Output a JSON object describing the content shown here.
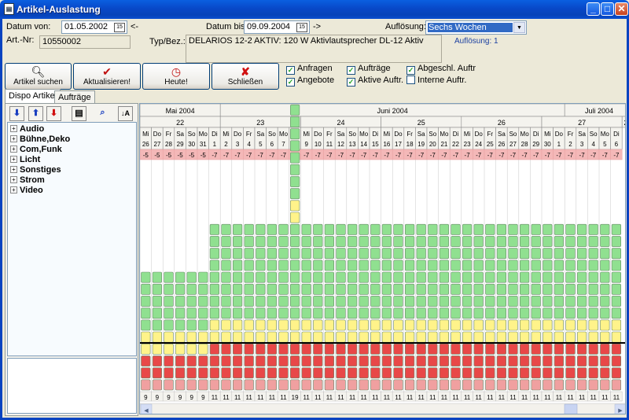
{
  "window": {
    "title": "Artikel-Auslastung"
  },
  "filter": {
    "datum_von_label": "Datum von:",
    "datum_von": "01.05.2002",
    "prev_arrow": "<-",
    "datum_bis_label": "Datum bis:",
    "datum_bis": "09.09.2004",
    "next_arrow": "->",
    "aufloesung_label": "Auflösung:",
    "aufloesung": "Sechs Wochen",
    "aufloesung_info": "Auflösung: 1"
  },
  "article": {
    "artnr_label": "Art.-Nr:",
    "artnr": "10550002",
    "typ_label": "Typ/Bez.:",
    "typ": "DELARIOS 12-2 AKTIV: 120 W Aktivlautsprecher DL-12 Aktiv"
  },
  "buttons": {
    "suchen": "Artikel suchen",
    "aktualisieren": "Aktualisieren!",
    "heute": "Heute!",
    "schliessen": "Schließen"
  },
  "checks": [
    {
      "label": "Anfragen",
      "checked": true
    },
    {
      "label": "Aufträge",
      "checked": true
    },
    {
      "label": "Abgeschl. Auftr",
      "checked": true
    },
    {
      "label": "Angebote",
      "checked": true
    },
    {
      "label": "Aktive Auftr.",
      "checked": true
    },
    {
      "label": "Interne Auftr.",
      "checked": false
    }
  ],
  "tabs": [
    "Dispo Artikel",
    "Aufträge"
  ],
  "tree": [
    "Audio",
    "Bühne,Deko",
    "Com,Funk",
    "Licht",
    "Sonstiges",
    "Strom",
    "Video"
  ],
  "grid": {
    "months": [
      {
        "label": "Mai 2004",
        "span": 7
      },
      {
        "label": "Juni 2004",
        "span": 30
      },
      {
        "label": "Juli 2004",
        "span": 6
      }
    ],
    "weeks": [
      {
        "label": "22",
        "span": 7
      },
      {
        "label": "23",
        "span": 7
      },
      {
        "label": "24",
        "span": 7
      },
      {
        "label": "25",
        "span": 7
      },
      {
        "label": "26",
        "span": 7
      },
      {
        "label": "27",
        "span": 7
      },
      {
        "label": "28",
        "span": 1
      }
    ],
    "weekdays": [
      "Mi",
      "Do",
      "Fr",
      "Sa",
      "So",
      "Mo",
      "Di",
      "Mi",
      "Do",
      "Fr",
      "Sa",
      "So",
      "Mo",
      "Di",
      "Mi",
      "Do",
      "Fr",
      "Sa",
      "So",
      "Mo",
      "Di",
      "Mi",
      "Do",
      "Fr",
      "Sa",
      "So",
      "Mo",
      "Di",
      "Mi",
      "Do",
      "Fr",
      "Sa",
      "So",
      "Mo",
      "Di",
      "Mi",
      "Do",
      "Fr",
      "Sa",
      "So",
      "Mo",
      "Di",
      "Mi"
    ],
    "days": [
      "26",
      "27",
      "28",
      "29",
      "30",
      "31",
      "1",
      "2",
      "3",
      "4",
      "5",
      "6",
      "7",
      "8",
      "9",
      "10",
      "11",
      "12",
      "13",
      "14",
      "15",
      "16",
      "17",
      "18",
      "19",
      "20",
      "21",
      "22",
      "23",
      "24",
      "25",
      "26",
      "27",
      "28",
      "29",
      "30",
      "1",
      "2",
      "3",
      "4",
      "5",
      "6"
    ],
    "today_index": 42,
    "balance": [
      "-5",
      "-5",
      "-5",
      "-5",
      "-5",
      "-5",
      "-7",
      "-7",
      "-7",
      "-7",
      "-7",
      "-7",
      "-7",
      "-15",
      "-7",
      "-7",
      "-7",
      "-7",
      "-7",
      "-7",
      "-7",
      "-7",
      "-7",
      "-7",
      "-7",
      "-7",
      "-7",
      "-7",
      "-7",
      "-7",
      "-7",
      "-7",
      "-7",
      "-7",
      "-7",
      "-7",
      "-7",
      "-7",
      "-7",
      "-7",
      "-7",
      "-7",
      "-7"
    ],
    "totals": [
      "9",
      "9",
      "9",
      "9",
      "9",
      "9",
      "11",
      "11",
      "11",
      "11",
      "11",
      "11",
      "11",
      "19",
      "11",
      "11",
      "11",
      "11",
      "11",
      "11",
      "11",
      "11",
      "11",
      "11",
      "11",
      "11",
      "11",
      "11",
      "11",
      "11",
      "11",
      "11",
      "11",
      "11",
      "11",
      "11",
      "11",
      "11",
      "11",
      "11",
      "11",
      "11",
      "11"
    ],
    "stacks_from_bottom": {
      "short": [
        "pink",
        "red",
        "red",
        "yellow",
        "yellow",
        "green",
        "green",
        "green",
        "green",
        "green"
      ],
      "normal": [
        "pink",
        "red",
        "red",
        "red",
        "yellow",
        "yellow",
        "green",
        "green",
        "green",
        "green",
        "green",
        "green",
        "green",
        "green"
      ],
      "tall": [
        "pink",
        "red",
        "red",
        "red",
        "yellow",
        "yellow",
        "green",
        "green",
        "green",
        "green",
        "green",
        "green",
        "green",
        "green",
        "yellow",
        "yellow",
        "green",
        "green",
        "green",
        "green",
        "green",
        "green",
        "green",
        "green"
      ]
    },
    "colors": {
      "green": "#90E090",
      "yellow": "#FFF38A",
      "red": "#E84848",
      "pink": "#F0A0A0",
      "today": "#1E8C1E",
      "balance_bg": "#F4B8B8"
    }
  }
}
